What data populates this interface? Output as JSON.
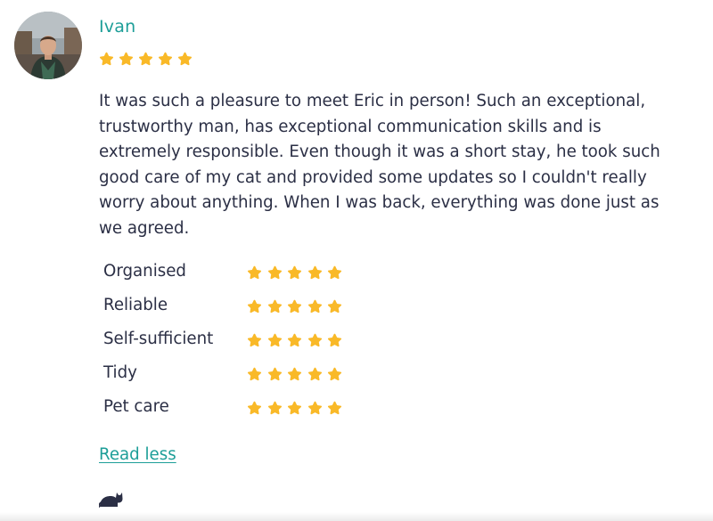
{
  "review": {
    "reviewer_name": "Ivan",
    "overall_rating": 5,
    "text": "It was such a pleasure to meet Eric in person! Such an exceptional, trustworthy man, has exceptional communication skills and is extremely responsible. Even though it was a short stay, he took such good care of my cat and provided some updates so I couldn't really worry about anything. When I was back, everything was done just as we agreed.",
    "ratings": [
      {
        "label": "Organised",
        "stars": 5
      },
      {
        "label": "Reliable",
        "stars": 5
      },
      {
        "label": "Self-sufficient",
        "stars": 5
      },
      {
        "label": "Tidy",
        "stars": 5
      },
      {
        "label": "Pet care",
        "stars": 5
      }
    ],
    "read_less_label": "Read less",
    "pet_icon": "cat-icon"
  },
  "colors": {
    "accent": "#1d9e98",
    "star": "#f9b928",
    "text": "#2b2f45"
  }
}
